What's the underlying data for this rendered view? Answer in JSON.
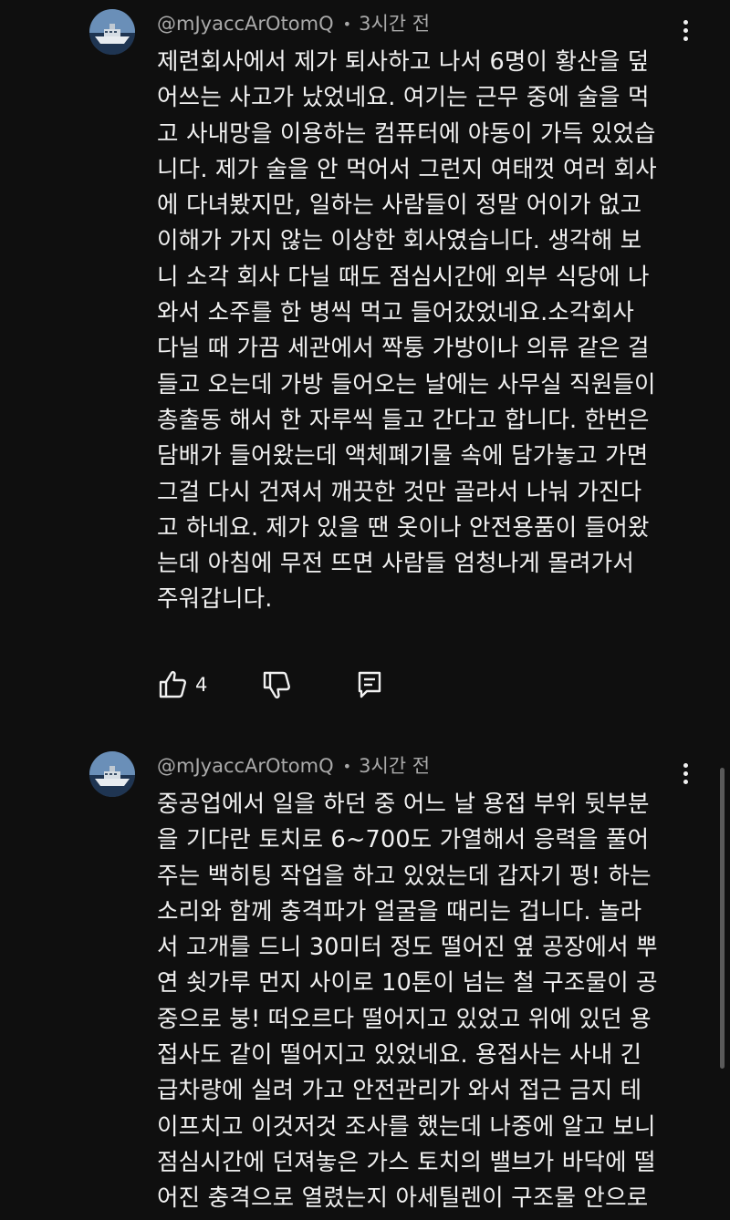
{
  "comments": [
    {
      "author": "@mJyaccArOtomQ",
      "separator": "•",
      "time": "3시간 전",
      "text": "제련회사에서 제가 퇴사하고 나서 6명이 황산을 덮\n어쓰는 사고가 났었네요. 여기는 근무 중에 술을 먹\n고 사내망을 이용하는 컴퓨터에 야동이 가득 있었습\n니다. 제가 술을 안 먹어서 그런지 여태껏 여러 회사\n에 다녀봤지만, 일하는 사람들이 정말 어이가 없고\n이해가 가지 않는 이상한 회사였습니다. 생각해 보\n니 소각 회사 다닐 때도 점심시간에 외부 식당에 나\n와서 소주를 한 병씩 먹고 들어갔었네요.소각회사\n다닐 때 가끔 세관에서 짝퉁 가방이나 의류 같은 걸\n들고 오는데 가방 들어오는 날에는 사무실 직원들이\n총출동 해서 한 자루씩 들고 간다고 합니다. 한번은\n담배가 들어왔는데 액체폐기물 속에 담가놓고 가면\n그걸 다시 건져서 깨끗한 것만 골라서 나눠 가진다\n고 하네요. 제가 있을 땐 옷이나 안전용품이 들어왔\n는데 아침에 무전 뜨면 사람들 엄청나게 몰려가서\n주워갑니다.",
      "likes": "4"
    },
    {
      "author": "@mJyaccArOtomQ",
      "separator": "•",
      "time": "3시간 전",
      "text": "중공업에서 일을 하던 중 어느 날 용접 부위 뒷부분\n을 기다란 토치로 6~700도 가열해서 응력을 풀어\n주는 백히팅 작업을 하고 있었는데 갑자기 펑! 하는\n소리와 함께 충격파가 얼굴을 때리는 겁니다. 놀라\n서 고개를 드니 30미터 정도 떨어진 옆 공장에서 뿌\n연 쇳가루 먼지 사이로 10톤이 넘는 철 구조물이 공\n중으로 붕! 떠오르다 떨어지고 있었고 위에 있던 용\n접사도 같이 떨어지고 있었네요. 용접사는 사내 긴\n급차량에 실려 가고 안전관리가 와서 접근 금지 테\n이프치고 이것저것 조사를 했는데 나중에 알고 보니\n점심시간에 던져놓은 가스 토치의 밸브가 바닥에 떨\n어진 충격으로 열렸는지 아세틸렌이 구조물 안으로"
    }
  ],
  "icons": {
    "avatar": "ship-avatar-icon",
    "more": "more-vert-icon",
    "like": "thumb-up-icon",
    "dislike": "thumb-down-icon",
    "reply": "reply-comment-icon"
  },
  "colors": {
    "background": "#0f0f0f",
    "text": "#f1f1f1",
    "meta": "#aaaaaa"
  }
}
